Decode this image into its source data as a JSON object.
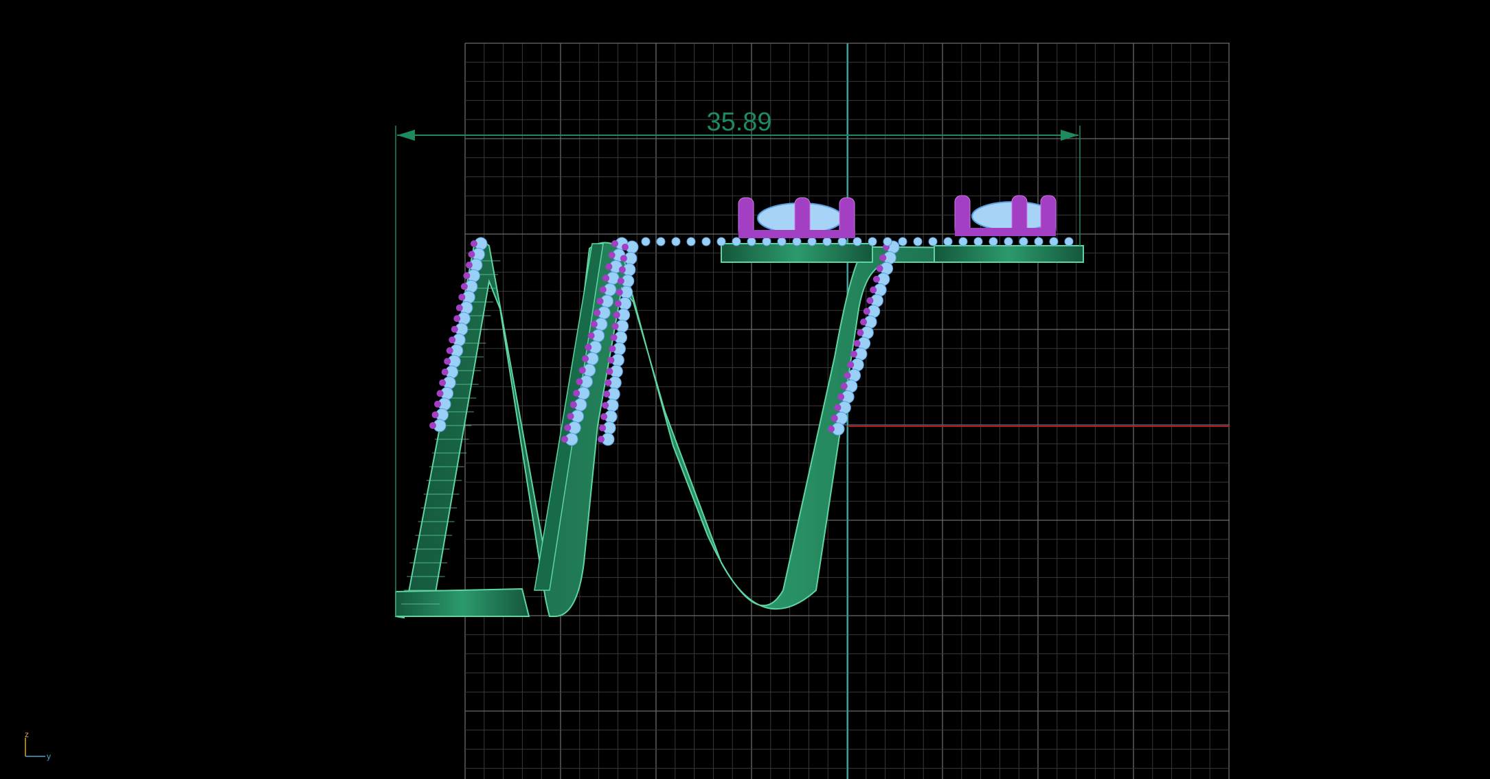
{
  "viewport": {
    "background": "#000000",
    "view": "side-view-wireframe"
  },
  "dimension": {
    "value": "35.89",
    "color": "#1f8a5e"
  },
  "colors": {
    "grid_minor": "#3a3a3a",
    "grid_major": "#6a6a6a",
    "axis_vertical": "#2aa7a0",
    "axis_horizontal": "#b01c1c",
    "band_fill": "#1f7a55",
    "band_edge": "#5fd6a2",
    "gem": "#9ad0f5",
    "prong": "#a33fc3"
  },
  "axis_indicator": {
    "z_label": "z",
    "y_label": "y",
    "z_color": "#d9a441",
    "y_color": "#4aa3c9"
  }
}
